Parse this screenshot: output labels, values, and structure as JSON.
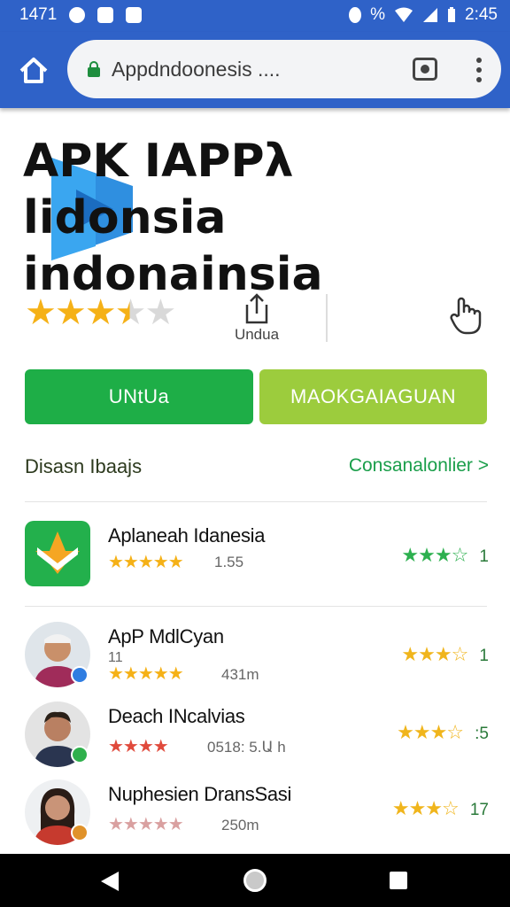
{
  "status_bar": {
    "time_left": "1471",
    "time_right": "2:45",
    "battery_pct": "%"
  },
  "browser": {
    "url": "Appdndoonesis ...."
  },
  "app": {
    "title_line1": "APK IAPPλ lidonsia",
    "title_line2": "indonainsia",
    "rating_stars": 3.5,
    "share_label": "Undua",
    "install_label": "UNtUa",
    "manage_label": "MAOKGAIAGUAN"
  },
  "section": {
    "title": "Disasn Ibaajs",
    "link": "Consanalonlier >"
  },
  "items": [
    {
      "name": "Aplaneah Idanesia",
      "sub": "",
      "meta": "1.55",
      "stars": "★★★★★",
      "right_stars": "★★★☆",
      "right_num": "1"
    },
    {
      "name": "ApP MdlCyan",
      "sub": "11",
      "meta": "431m",
      "stars": "★★★★★",
      "right_stars": "★★★☆",
      "right_num": "1"
    },
    {
      "name": "Deach INcalvias",
      "sub": "",
      "meta": "0518: 5.Ա h",
      "stars": "★★★★",
      "right_stars": "★★★☆",
      "right_num": ":5"
    },
    {
      "name": "Nuphesien DransSasi",
      "sub": "",
      "meta": "250m",
      "stars": "★★★★★",
      "right_stars": "★★★☆",
      "right_num": "17"
    }
  ],
  "colors": {
    "primary": "#2f62c8",
    "install": "#1eae47",
    "manage": "#9ccc3d",
    "star": "#f5b117",
    "star_red": "#e04a3c"
  }
}
